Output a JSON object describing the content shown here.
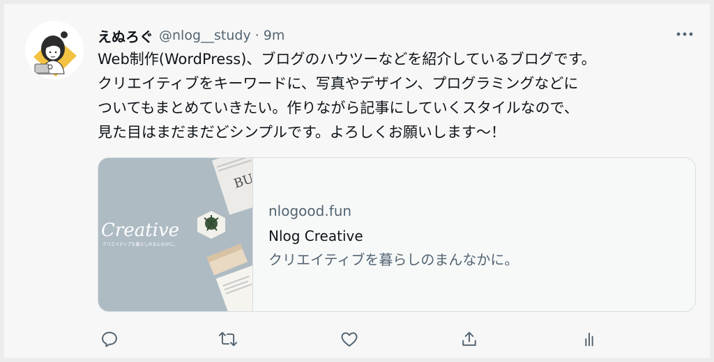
{
  "tweet": {
    "author": {
      "display_name": "えぬろぐ",
      "handle": "@nlog__study",
      "separator": "·",
      "time": "9m",
      "avatar_icon": "illustrated-woman-avatar-icon"
    },
    "text_lines": [
      "Web制作(WordPress)、ブログのハウツーなどを紹介しているブログです。",
      "クリエイティブをキーワードに、写真やデザイン、プログラミングなどに",
      "ついてもまとめていきたい。作りながら記事にしていくスタイルなので、",
      "見た目はまだまだどシンプルです。よろしくお願いします〜！"
    ],
    "more_icon": "more-horizontal-icon",
    "link_card": {
      "domain": "nlogood.fun",
      "title": "Nlog Creative",
      "description": "クリエイティブを暮らしのまんなかに。",
      "thumbnail": {
        "script_text": "Creative",
        "tagline": "クリエイティブを暮らしのまんなかに。",
        "magazine_text": "BU",
        "background_color": "#aab7c0"
      }
    },
    "actions": [
      {
        "name": "reply-icon"
      },
      {
        "name": "retweet-icon"
      },
      {
        "name": "like-icon"
      },
      {
        "name": "share-icon"
      },
      {
        "name": "analytics-icon"
      }
    ]
  },
  "colors": {
    "primary_text": "#0f1419",
    "secondary_text": "#536471",
    "card_border": "#d7dde1",
    "background": "#f7f7f7"
  }
}
